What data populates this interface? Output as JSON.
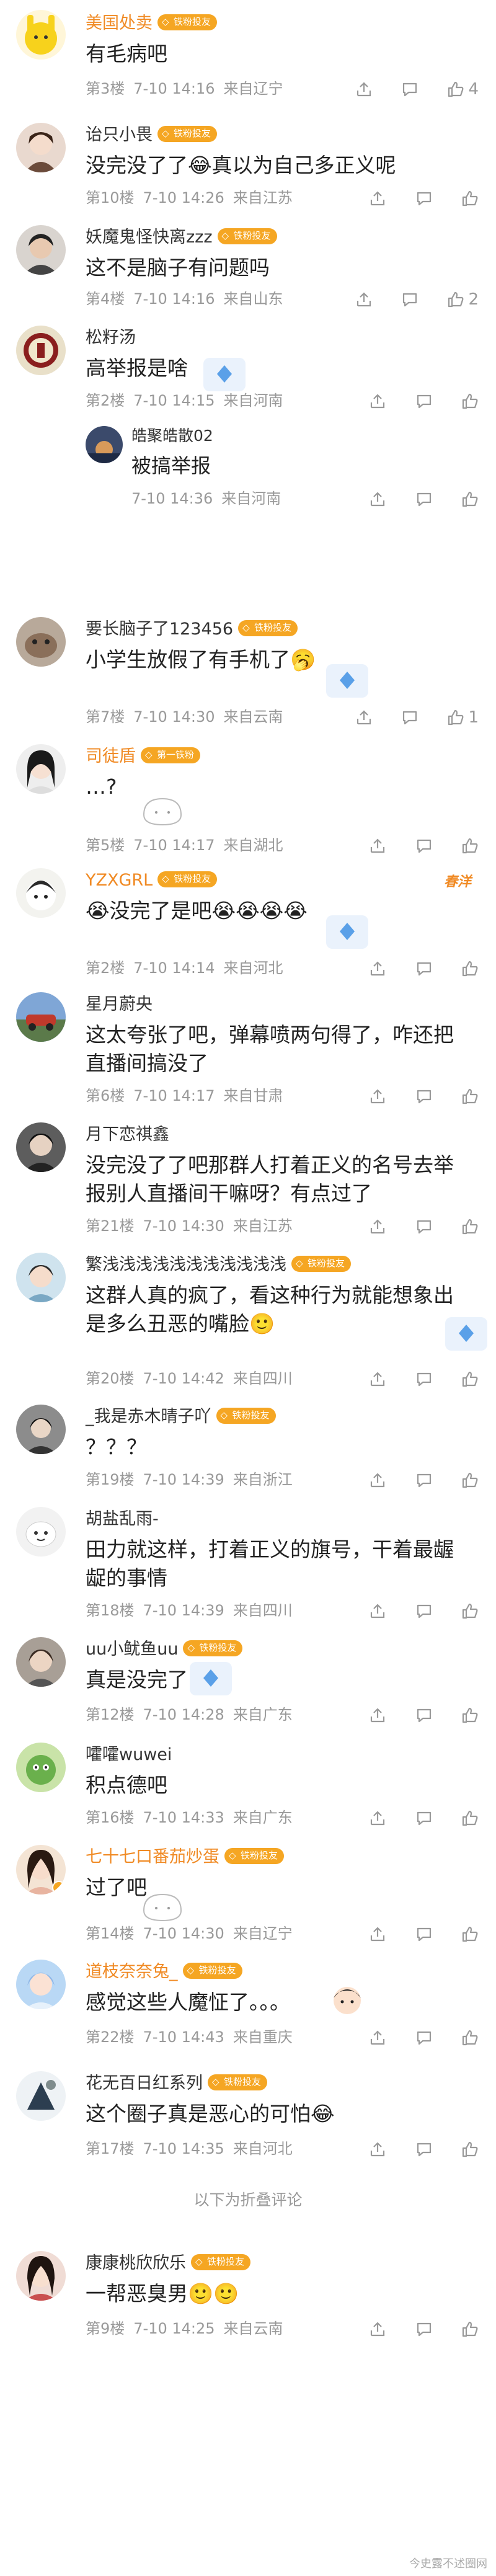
{
  "colors": {
    "orange": "#f08a24",
    "blue": "#4a7dbf",
    "gray_name": "#333333",
    "meta": "#999999"
  },
  "comments": [
    {
      "id": "c1",
      "name": "美国处卖",
      "name_color": "#f08a24",
      "badge": "铁粉投友",
      "badge_color": "#f5a623",
      "text": "有毛病吧",
      "floor": "第3楼",
      "time": "7-10 14:16",
      "loc": "来自辽宁",
      "likes": "4",
      "sticker": false
    },
    {
      "id": "c2",
      "name": "诒只小畏",
      "name_color": "#333333",
      "badge": "铁粉投友",
      "badge_color": "#f5a623",
      "text": "没完没了了😂真以为自己多正义呢",
      "floor": "第10楼",
      "time": "7-10 14:26",
      "loc": "来自江苏",
      "likes": "",
      "sticker": false
    },
    {
      "id": "c3",
      "name": "妖魔鬼怪快离zzz",
      "name_color": "#333333",
      "badge": "铁粉投友",
      "badge_color": "#f5a623",
      "text": "这不是脑子有问题吗",
      "floor": "第4楼",
      "time": "7-10 14:16",
      "loc": "来自山东",
      "likes": "2",
      "sticker": false
    },
    {
      "id": "c4",
      "name": "松籽汤",
      "name_color": "#333333",
      "badge": "",
      "badge_color": "",
      "text": "高举报是啥",
      "floor": "第2楼",
      "time": "7-10 14:15",
      "loc": "来自河南",
      "likes": "",
      "sticker": true
    },
    {
      "id": "c6",
      "name": "要长脑子了123456",
      "name_color": "#333333",
      "badge": "铁粉投友",
      "badge_color": "#f5a623",
      "text": "小学生放假了有手机了🥱",
      "floor": "第7楼",
      "time": "7-10 14:30",
      "loc": "来自云南",
      "likes": "1",
      "sticker": true
    },
    {
      "id": "c7",
      "name": "司徒盾",
      "name_color": "#f08a24",
      "badge": "第一铁粉",
      "badge_color": "#f5a623",
      "text": "…?",
      "floor": "第5楼",
      "time": "7-10 14:17",
      "loc": "来自湖北",
      "likes": "",
      "sticker": false
    },
    {
      "id": "c8",
      "name": "YZXGRL",
      "name_color": "#f08a24",
      "badge": "铁粉投友",
      "badge_color": "#f5a623",
      "text": "😭没完了是吧😭😭😭😭",
      "floor": "第2楼",
      "time": "7-10 14:14",
      "loc": "来自河北",
      "likes": "",
      "sticker": true
    },
    {
      "id": "c9",
      "name": "星月蔚央",
      "name_color": "#333333",
      "badge": "",
      "badge_color": "",
      "text": "这太夸张了吧，弹幕喷两句得了，咋还把直播间搞没了",
      "floor": "第6楼",
      "time": "7-10 14:17",
      "loc": "来自甘肃",
      "likes": "",
      "sticker": false
    },
    {
      "id": "c10",
      "name": "月下恋祺鑫",
      "name_color": "#333333",
      "badge": "",
      "badge_color": "",
      "text": "没完没了了吧那群人打着正义的名号去举报别人直播间干嘛呀？有点过了",
      "floor": "第21楼",
      "time": "7-10 14:30",
      "loc": "来自江苏",
      "likes": "",
      "sticker": false
    },
    {
      "id": "c11",
      "name": "繁浅浅浅浅浅浅浅浅浅浅浅",
      "name_color": "#333333",
      "badge": "铁粉投友",
      "badge_color": "#f5a623",
      "text": "这群人真的疯了，看这种行为就能想象出是多么丑恶的嘴脸🙂",
      "floor": "第20楼",
      "time": "7-10 14:42",
      "loc": "来自四川",
      "likes": "",
      "sticker": true
    },
    {
      "id": "c12",
      "name": "_我是赤木晴子吖",
      "name_color": "#333333",
      "badge": "铁粉投友",
      "badge_color": "#f5a623",
      "text": "？？？",
      "floor": "第19楼",
      "time": "7-10 14:39",
      "loc": "来自浙江",
      "likes": "",
      "sticker": false
    },
    {
      "id": "c13",
      "name": "胡盐乱雨-",
      "name_color": "#333333",
      "badge": "",
      "badge_color": "",
      "text": "田力就这样，打着正义的旗号，干着最龌龊的事情",
      "floor": "第18楼",
      "time": "7-10 14:39",
      "loc": "来自四川",
      "likes": "",
      "sticker": false
    },
    {
      "id": "c14",
      "name": "uu小鱿鱼uu",
      "name_color": "#333333",
      "badge": "铁粉投友",
      "badge_color": "#f5a623",
      "text": "真是没完了",
      "floor": "第12楼",
      "time": "7-10 14:28",
      "loc": "来自广东",
      "likes": "",
      "sticker": true
    },
    {
      "id": "c15",
      "name": "嚯嚯wuwei",
      "name_color": "#333333",
      "badge": "",
      "badge_color": "",
      "text": "积点德吧",
      "floor": "第16楼",
      "time": "7-10 14:33",
      "loc": "来自广东",
      "likes": "",
      "sticker": false
    },
    {
      "id": "c16",
      "name": "七十七口番茄炒蛋",
      "name_color": "#f08a24",
      "badge": "铁粉投友",
      "badge_color": "#f5a623",
      "text": "过了吧",
      "floor": "第14楼",
      "time": "7-10 14:30",
      "loc": "来自辽宁",
      "likes": "",
      "sticker": false
    },
    {
      "id": "c17",
      "name": "道枝奈奈兔_",
      "name_color": "#f08a24",
      "badge": "铁粉投友",
      "badge_color": "#f5a623",
      "text": "感觉这些人魔怔了。。。",
      "floor": "第22楼",
      "time": "7-10 14:43",
      "loc": "来自重庆",
      "likes": "",
      "sticker": false
    },
    {
      "id": "c18",
      "name": "花无百日红系列",
      "name_color": "#333333",
      "badge": "铁粉投友",
      "badge_color": "#f5a623",
      "text": "这个圈子真是恶心的可怕😂",
      "floor": "第17楼",
      "time": "7-10 14:35",
      "loc": "来自河北",
      "likes": "",
      "sticker": false
    },
    {
      "id": "c19",
      "name": "康康桃欣欣乐",
      "name_color": "#333333",
      "badge": "铁粉投友",
      "badge_color": "#f5a623",
      "text": "一帮恶臭男🙂🙂",
      "floor": "第9楼",
      "time": "7-10 14:25",
      "loc": "来自云南",
      "likes": "",
      "sticker": false
    }
  ],
  "reply": {
    "name": "皓聚皓散02",
    "text": "被搞举报",
    "time": "7-10 14:36",
    "loc": "来自河南"
  },
  "folded_label": "以下为折叠评论",
  "vip_mark": "春洋",
  "watermark": "今史露不述圈网"
}
